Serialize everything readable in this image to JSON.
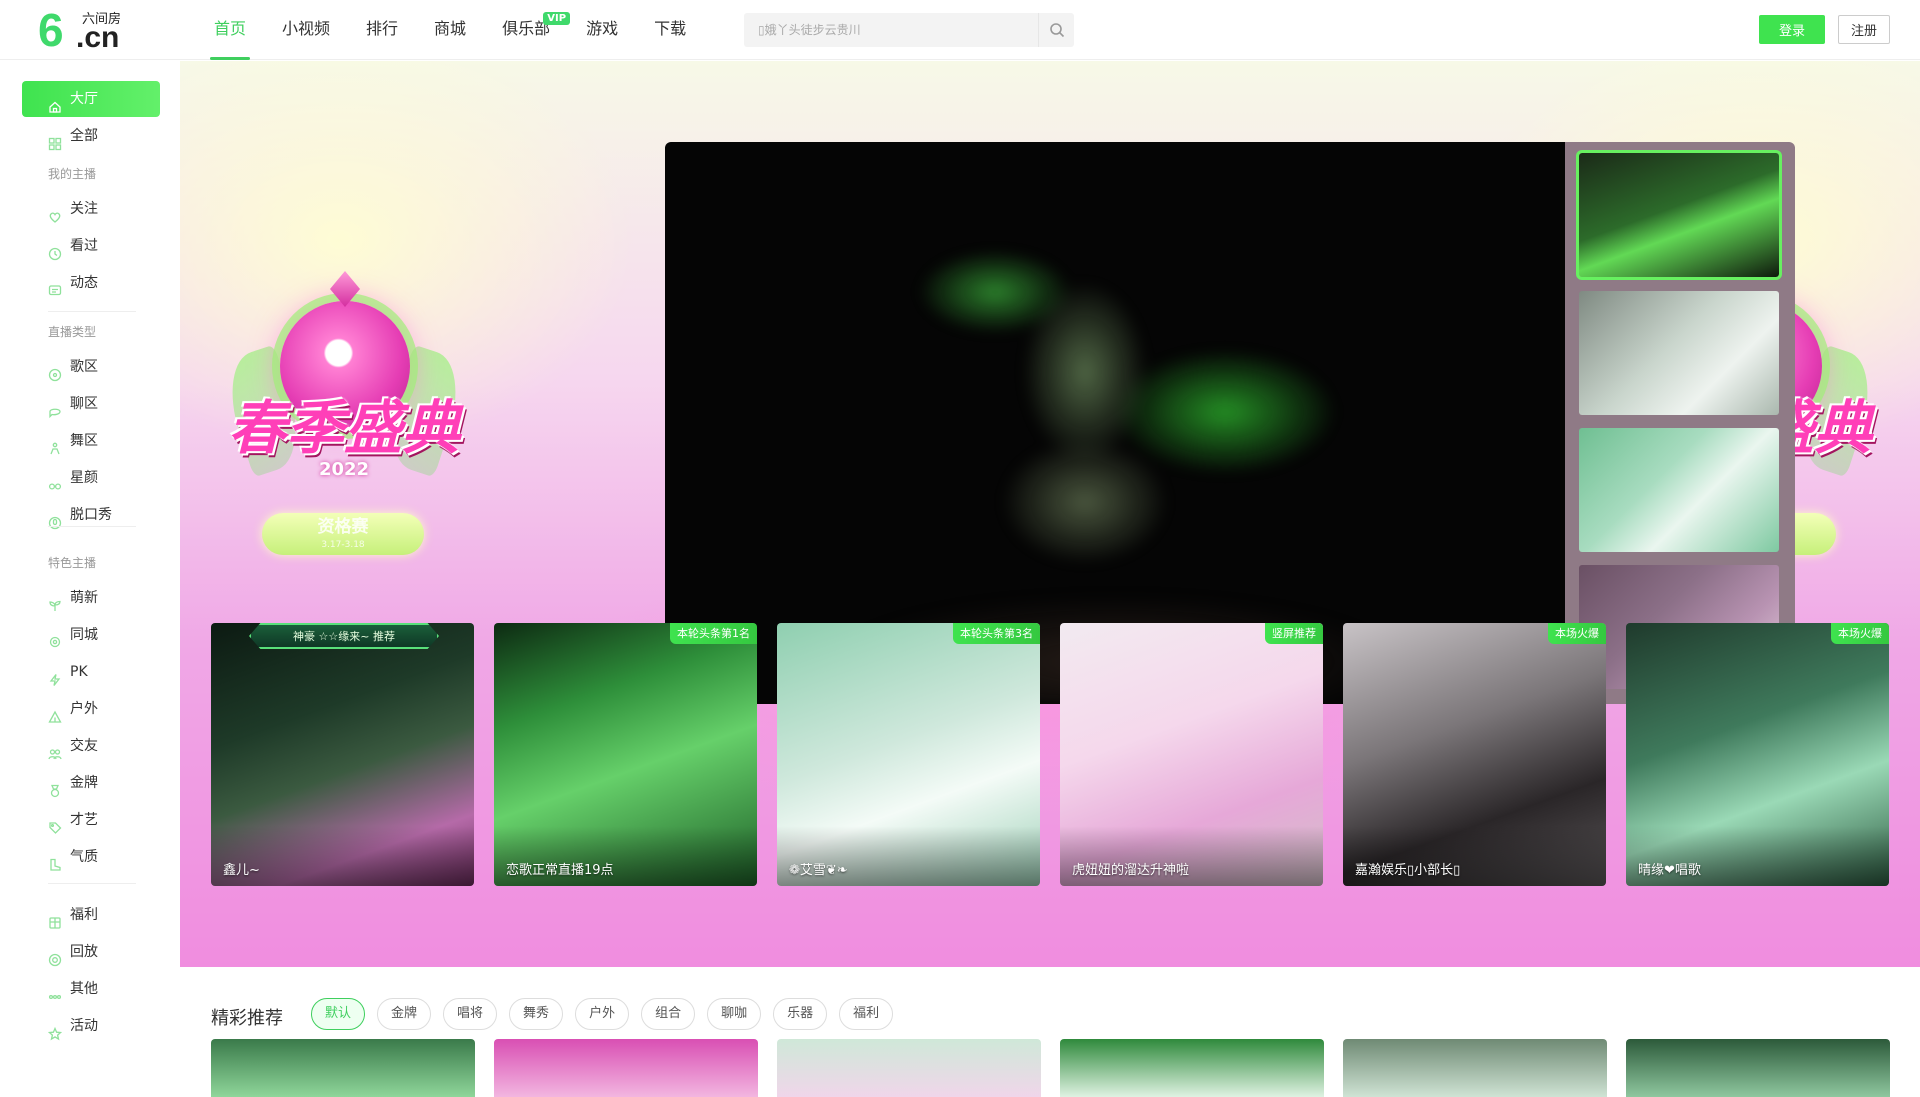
{
  "header": {
    "logo_brand": "六间房",
    "logo_main": "6",
    "logo_cn": ".cn",
    "nav": [
      {
        "label": "首页",
        "active": true
      },
      {
        "label": "小视频"
      },
      {
        "label": "排行"
      },
      {
        "label": "商城"
      },
      {
        "label": "俱乐部",
        "badge": "VIP"
      },
      {
        "label": "游戏"
      },
      {
        "label": "下载"
      }
    ],
    "search_placeholder": "▯娥丫头徒步云贵川",
    "login_label": "登录",
    "register_label": "注册"
  },
  "sidebar": {
    "top": [
      {
        "label": "大厅",
        "icon": "home-icon",
        "active": true
      },
      {
        "label": "全部",
        "icon": "grid-icon"
      }
    ],
    "group_my": "我的主播",
    "my": [
      {
        "label": "关注",
        "icon": "heart-icon"
      },
      {
        "label": "看过",
        "icon": "clock-icon"
      },
      {
        "label": "动态",
        "icon": "message-icon"
      }
    ],
    "group_type": "直播类型",
    "types": [
      {
        "label": "歌区",
        "icon": "music-icon"
      },
      {
        "label": "聊区",
        "icon": "chat-icon"
      },
      {
        "label": "舞区",
        "icon": "dance-icon"
      },
      {
        "label": "星颜",
        "icon": "glasses-icon"
      },
      {
        "label": "脱口秀",
        "icon": "mic-icon"
      }
    ],
    "group_feature": "特色主播",
    "features": [
      {
        "label": "萌新",
        "icon": "sprout-icon"
      },
      {
        "label": "同城",
        "icon": "location-icon"
      },
      {
        "label": "PK",
        "icon": "bolt-icon"
      },
      {
        "label": "户外",
        "icon": "tent-icon"
      },
      {
        "label": "交友",
        "icon": "friends-icon"
      },
      {
        "label": "金牌",
        "icon": "medal-icon"
      },
      {
        "label": "才艺",
        "icon": "tag-icon"
      },
      {
        "label": "气质",
        "icon": "boot-icon"
      }
    ],
    "bottom": [
      {
        "label": "福利",
        "icon": "gift-icon"
      },
      {
        "label": "回放",
        "icon": "replay-icon"
      },
      {
        "label": "其他",
        "icon": "dots-icon"
      },
      {
        "label": "活动",
        "icon": "star-icon"
      }
    ]
  },
  "banner": {
    "festival_title": "春季盛典",
    "festival_year": "2022",
    "festival_pill": "资格赛",
    "festival_date": "3.17-3.18"
  },
  "hot_cards": [
    {
      "name": "鑫儿~",
      "ribbon": "神豪 ☆☆缘来~ 推荐",
      "tag": ""
    },
    {
      "name": "恋歌正常直播19点",
      "tag": "本轮头条第1名"
    },
    {
      "name": "❁艾雪❦❧",
      "tag": "本轮头条第3名"
    },
    {
      "name": "虎妞妞的溜达升神啦",
      "tag": "竖屏推荐"
    },
    {
      "name": "嘉瀚娱乐▯小部长▯",
      "tag": "本场火爆"
    },
    {
      "name": "晴缘❤唱歌",
      "tag": "本场火爆"
    }
  ],
  "recommend": {
    "title": "精彩推荐",
    "filters": [
      "默认",
      "金牌",
      "唱将",
      "舞秀",
      "户外",
      "组合",
      "聊咖",
      "乐器",
      "福利"
    ],
    "active_filter": "默认"
  },
  "colors": {
    "accent": "#3fcf5e",
    "login_bg": "#3fe34f",
    "tag_bg": "#3fe34f"
  }
}
